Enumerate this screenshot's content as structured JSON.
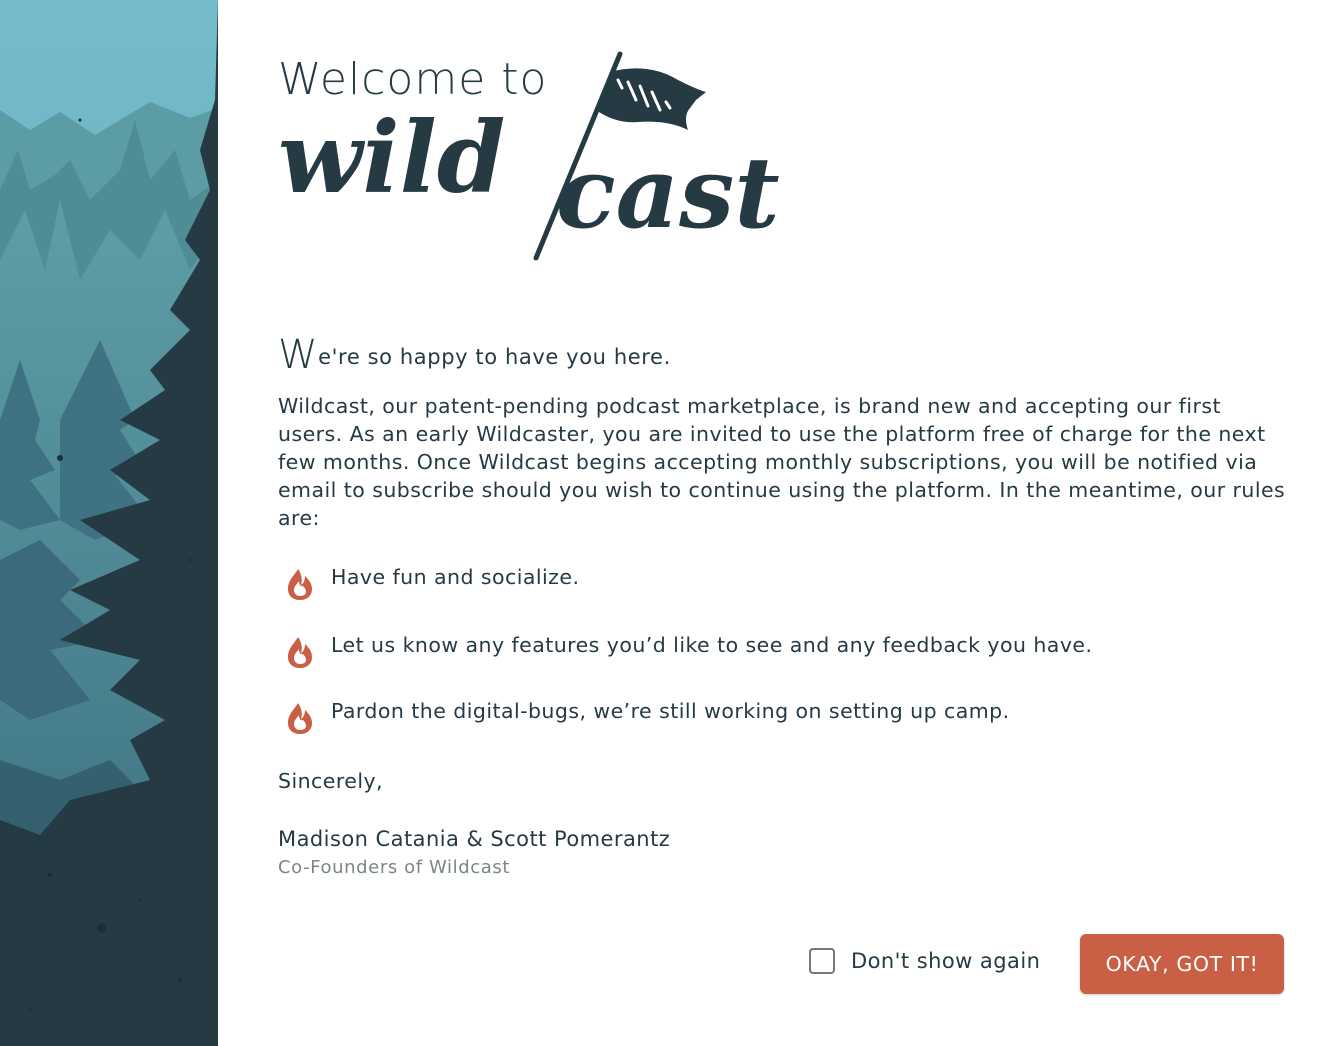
{
  "welcome": {
    "prefix": "Welcome to",
    "brand": "wildcast"
  },
  "greeting": {
    "dropcap": "W",
    "rest": "e're so happy to have you here."
  },
  "intro": "Wildcast, our patent-pending podcast marketplace, is brand new and accepting our first users. As an early Wildcaster, you are invited to use the platform free of charge for the next few months. Once Wildcast begins accepting monthly subscriptions, you will be notified via email to subscribe should you wish to continue using the platform. In the meantime, our rules are:",
  "rules": [
    {
      "icon": "flame-icon",
      "text": "Have fun and socialize."
    },
    {
      "icon": "flame-icon",
      "text": "Let us know any features you’d like to see and any feedback you have."
    },
    {
      "icon": "flame-icon",
      "text": "Pardon the digital-bugs, we’re still working on setting up camp."
    }
  ],
  "signoff": "Sincerely,",
  "founders": {
    "names": "Madison Catania & Scott Pomerantz",
    "title": "Co-Founders of Wildcast"
  },
  "footer": {
    "dont_show_label": "Don't show again",
    "dont_show_checked": false,
    "ok_label": "OKAY, GOT IT!"
  },
  "colors": {
    "accent": "#c95f44",
    "text": "#263a44",
    "muted": "#7b868b",
    "sky": "#6fb5c5",
    "forest_dark": "#253a42"
  }
}
